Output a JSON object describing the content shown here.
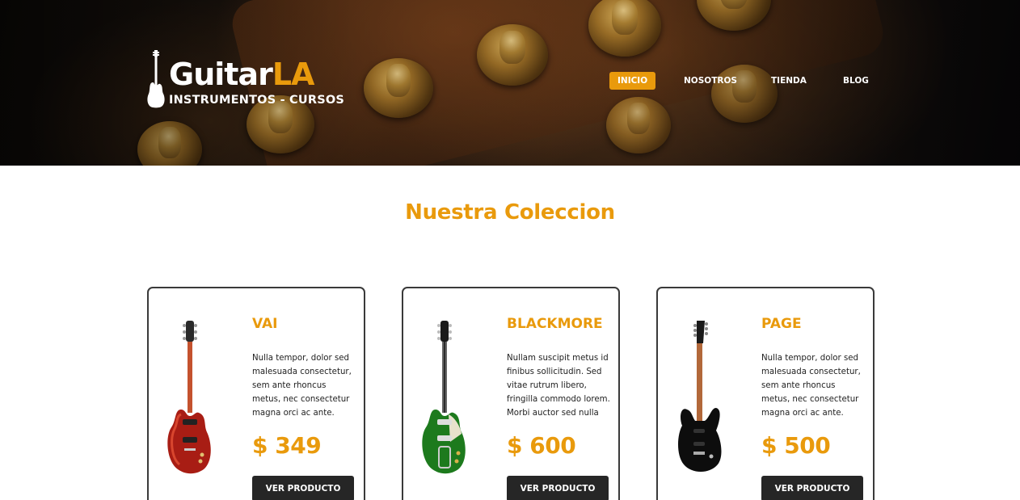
{
  "brand": {
    "name_part1": "Guitar",
    "name_part2": "LA",
    "tagline": "INSTRUMENTOS - CURSOS",
    "accent_color": "#e99a0c"
  },
  "nav": {
    "items": [
      {
        "label": "INICIO",
        "active": true
      },
      {
        "label": "NOSOTROS",
        "active": false
      },
      {
        "label": "TIENDA",
        "active": false
      },
      {
        "label": "BLOG",
        "active": false
      }
    ]
  },
  "main": {
    "title": "Nuestra Coleccion",
    "products": [
      {
        "name": "VAI",
        "description": "Nulla tempor, dolor sed malesuada consectetur, sem ante rhoncus metus, nec consectetur magna orci ac ante. Vestibulu...",
        "price": "$ 349",
        "button_label": "VER PRODUCTO",
        "image_icon": "red-les-paul-guitar-icon"
      },
      {
        "name": "BLACKMORE",
        "description": "Nullam suscipit metus id finibus sollicitudin. Sed vitae rutrum libero, fringilla commodo lorem. Morbi auctor sed nulla i...",
        "price": "$ 600",
        "button_label": "VER PRODUCTO",
        "image_icon": "green-les-paul-guitar-icon"
      },
      {
        "name": "PAGE",
        "description": "Nulla tempor, dolor sed malesuada consectetur, sem ante rhoncus metus, nec consectetur magna orci ac ante. Vestibulu...",
        "price": "$ 500",
        "button_label": "VER PRODUCTO",
        "image_icon": "black-superstrat-guitar-icon"
      }
    ]
  }
}
